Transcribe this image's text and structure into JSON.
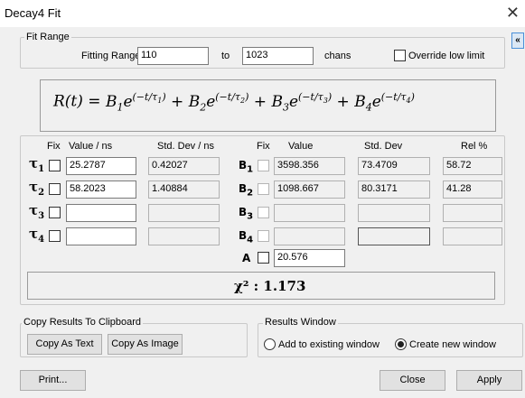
{
  "window": {
    "title": "Decay4   Fit",
    "close_symbol": "✕"
  },
  "fit_range": {
    "legend": "Fit Range",
    "fitting_range_label": "Fitting Range",
    "from_value": "110",
    "to_label": "to",
    "to_value": "1023",
    "units_label": "chans",
    "override_label": "Override low limit",
    "collapse_symbol": "«"
  },
  "formula": {
    "lhs": "R(t) = ",
    "terms": [
      {
        "coef": "B",
        "idx": "1",
        "tau": "1"
      },
      {
        "coef": "B",
        "idx": "2",
        "tau": "2"
      },
      {
        "coef": "B",
        "idx": "3",
        "tau": "3"
      },
      {
        "coef": "B",
        "idx": "4",
        "tau": "4"
      }
    ]
  },
  "lifetime_table": {
    "headers": {
      "fix": "Fix",
      "value": "Value / ns",
      "std_dev": "Std. Dev / ns"
    },
    "rows": [
      {
        "symbol": "τ",
        "idx": "1",
        "value": "25.2787",
        "std_dev": "0.42027"
      },
      {
        "symbol": "τ",
        "idx": "2",
        "value": "58.2023",
        "std_dev": "1.40884"
      },
      {
        "symbol": "τ",
        "idx": "3",
        "value": "",
        "std_dev": ""
      },
      {
        "symbol": "τ",
        "idx": "4",
        "value": "",
        "std_dev": ""
      }
    ]
  },
  "amplitude_table": {
    "headers": {
      "fix": "Fix",
      "value": "Value",
      "std_dev": "Std. Dev",
      "rel": "Rel %"
    },
    "rows": [
      {
        "symbol": "B",
        "idx": "1",
        "value": "3598.356",
        "std_dev": "73.4709",
        "rel": "58.72"
      },
      {
        "symbol": "B",
        "idx": "2",
        "value": "1098.667",
        "std_dev": "80.3171",
        "rel": "41.28"
      },
      {
        "symbol": "B",
        "idx": "3",
        "value": "",
        "std_dev": "",
        "rel": ""
      },
      {
        "symbol": "B",
        "idx": "4",
        "value": "",
        "std_dev": "",
        "rel": ""
      }
    ],
    "offset": {
      "symbol": "A",
      "value": "20.576"
    }
  },
  "chi_squared": {
    "label": "χ² : ",
    "value": "1.173"
  },
  "clipboard": {
    "legend": "Copy Results To Clipboard",
    "copy_text_label": "Copy As Text",
    "copy_image_label": "Copy As Image"
  },
  "results_window": {
    "legend": "Results Window",
    "add_existing_label": "Add to existing window",
    "create_new_label": "Create new window",
    "selected": "create_new"
  },
  "footer": {
    "print_label": "Print...",
    "close_label": "Close",
    "apply_label": "Apply"
  }
}
